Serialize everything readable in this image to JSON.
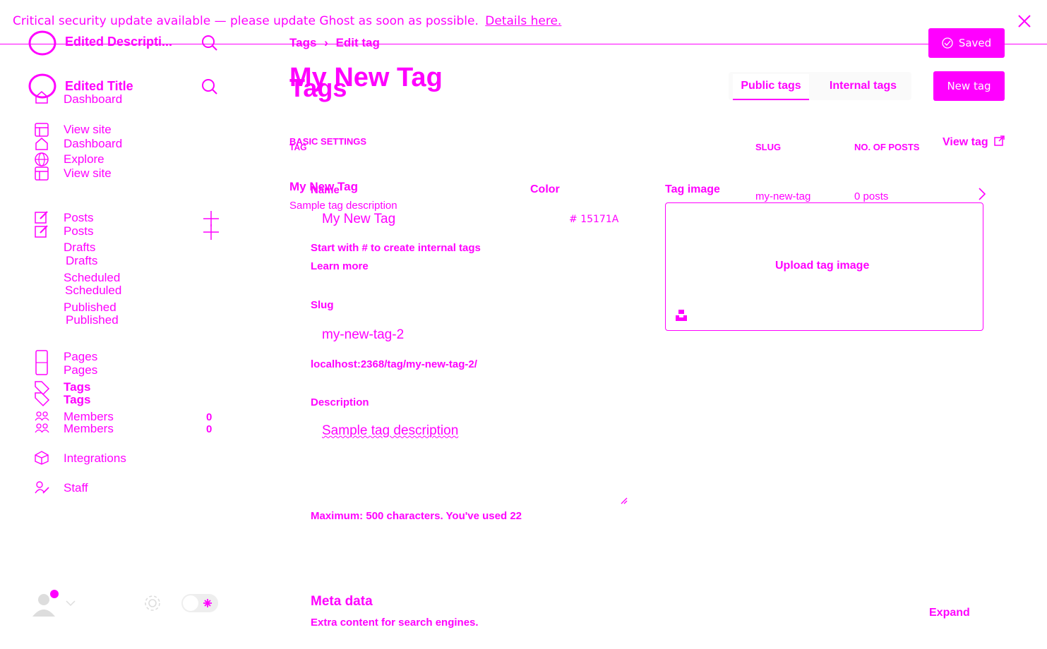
{
  "banner": {
    "message": "Critical security update available — please update Ghost as soon as possible.",
    "link": "Details here."
  },
  "sidebar": {
    "site_title_a": "Edited Descripti...",
    "site_title_b": "Edited Title",
    "items_a": {
      "dashboard": "Dashboard",
      "view_site": "View site",
      "explore": "Explore",
      "posts": "Posts",
      "drafts": "Drafts",
      "scheduled": "Scheduled",
      "published": "Published",
      "pages": "Pages",
      "tags": "Tags",
      "members": "Members",
      "members_count": "0",
      "integrations": "Integrations",
      "staff": "Staff"
    },
    "items_b": {
      "view_site": "View site",
      "dashboard": "Dashboard",
      "posts": "Posts",
      "drafts": "Drafts",
      "scheduled": "Scheduled",
      "published": "Published",
      "pages": "Pages",
      "tags": "Tags",
      "members": "Members",
      "members_count": "0"
    }
  },
  "list_view": {
    "title": "Tags",
    "tabs": [
      "Public tags",
      "Internal tags"
    ],
    "new_button": "New tag",
    "columns": [
      "TAG",
      "SLUG",
      "NO. OF POSTS"
    ],
    "rows": [
      {
        "name": "My New Tag",
        "description": "Sample tag description",
        "slug": "my-new-tag",
        "posts": "0 posts"
      }
    ]
  },
  "editor": {
    "breadcrumb": [
      "Tags",
      "Edit tag"
    ],
    "title": "My New Tag",
    "saved_button": "Saved",
    "section_label": "BASIC SETTINGS",
    "view_tag_link": "View tag",
    "name_label": "Name",
    "name_value": "My New Tag",
    "color_label": "Color",
    "color_hash": "#",
    "color_value": "15171A",
    "name_hint": "Start with # to create internal tags",
    "learn_more": "Learn more",
    "slug_label": "Slug",
    "slug_value": "my-new-tag-2",
    "slug_url": "localhost:2368/tag/my-new-tag-2/",
    "description_label": "Description",
    "description_value": "Sample tag description",
    "char_max_prefix": "Maximum: ",
    "char_max": "500",
    "char_mid": " characters. You've used ",
    "char_used": "22",
    "tag_image_label": "Tag image",
    "upload_label": "Upload tag image",
    "meta_title": "Meta data",
    "meta_subtitle": "Extra content for search engines.",
    "expand": "Expand"
  },
  "colors": {
    "accent": "#ff00ff",
    "background": "#ffffff"
  }
}
